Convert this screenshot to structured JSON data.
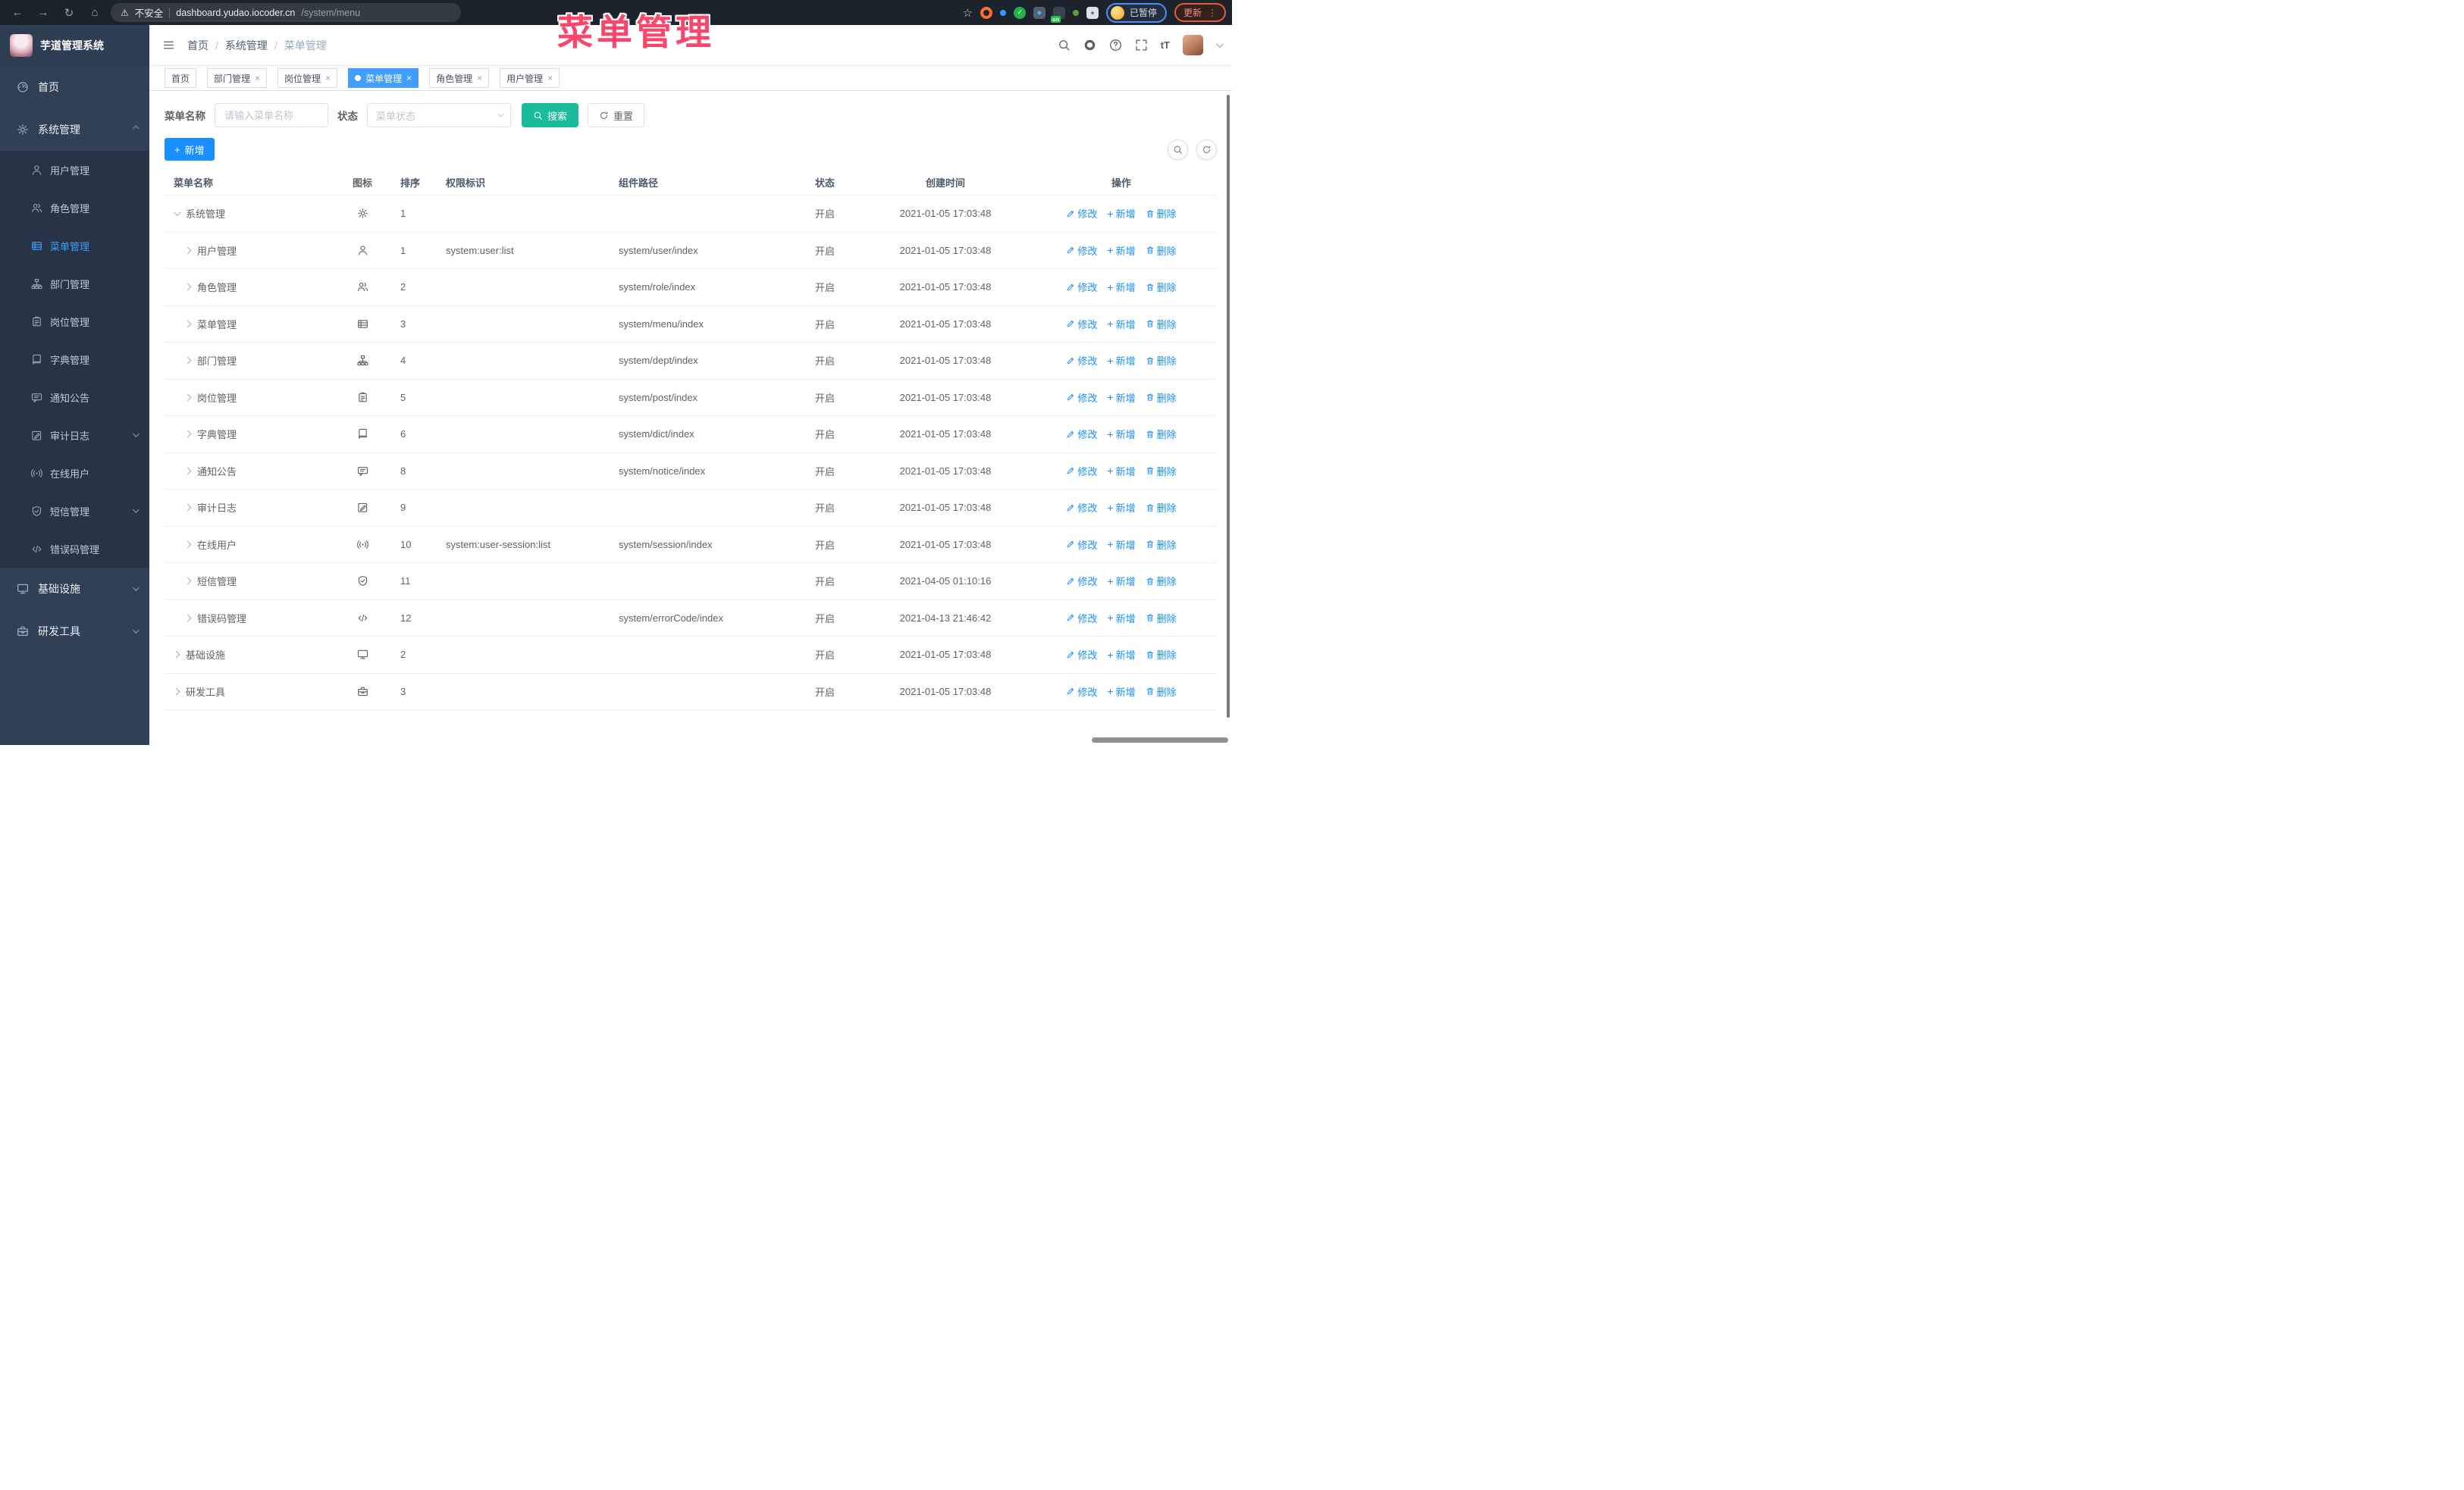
{
  "browser": {
    "security_label": "不安全",
    "url_host": "dashboard.yudao.iocoder.cn",
    "url_path": "/system/menu",
    "extensions": [
      {
        "shape": "ring",
        "color": "#ff6d2e"
      },
      {
        "shape": "dot",
        "color": "#2f9bff"
      },
      {
        "shape": "check",
        "color": "#23b14d"
      },
      {
        "shape": "diamond",
        "color": "#55606e",
        "accent": "#41b4ff"
      },
      {
        "shape": "on",
        "color": "#3a4350",
        "accent": "#23c343"
      },
      {
        "shape": "dot",
        "color": "#5f9c3c"
      },
      {
        "shape": "puzzle",
        "color": "#dfe3e8"
      }
    ],
    "on_badge": "on",
    "profile_badge": "已暂停",
    "update_label": "更新"
  },
  "watermark": "菜单管理",
  "sidebar": {
    "app_title": "芋道管理系统",
    "menu": [
      {
        "label": "首页",
        "icon": "dashboard"
      },
      {
        "label": "系统管理",
        "icon": "gear",
        "caret": "up",
        "children": [
          {
            "label": "用户管理",
            "icon": "user"
          },
          {
            "label": "角色管理",
            "icon": "users"
          },
          {
            "label": "菜单管理",
            "icon": "menu-list",
            "active": true
          },
          {
            "label": "部门管理",
            "icon": "org-tree"
          },
          {
            "label": "岗位管理",
            "icon": "id-badge"
          },
          {
            "label": "字典管理",
            "icon": "book"
          },
          {
            "label": "通知公告",
            "icon": "message"
          },
          {
            "label": "审计日志",
            "icon": "logpen",
            "caret": "down"
          },
          {
            "label": "在线用户",
            "icon": "online"
          },
          {
            "label": "短信管理",
            "icon": "shield",
            "caret": "down"
          },
          {
            "label": "错误码管理",
            "icon": "code"
          }
        ]
      },
      {
        "label": "基础设施",
        "icon": "monitor",
        "caret": "down"
      },
      {
        "label": "研发工具",
        "icon": "toolbox",
        "caret": "down"
      }
    ]
  },
  "header": {
    "breadcrumb": [
      "首页",
      "系统管理",
      "菜单管理"
    ]
  },
  "tabs": [
    {
      "label": "首页",
      "closable": false,
      "active": false
    },
    {
      "label": "部门管理",
      "closable": true,
      "active": false
    },
    {
      "label": "岗位管理",
      "closable": true,
      "active": false
    },
    {
      "label": "菜单管理",
      "closable": true,
      "active": true
    },
    {
      "label": "角色管理",
      "closable": true,
      "active": false
    },
    {
      "label": "用户管理",
      "closable": true,
      "active": false
    }
  ],
  "filter": {
    "name_label": "菜单名称",
    "name_placeholder": "请输入菜单名称",
    "status_label": "状态",
    "status_placeholder": "菜单状态",
    "search_label": "搜索",
    "reset_label": "重置"
  },
  "toolbar": {
    "add_label": "新增"
  },
  "table": {
    "columns": [
      "菜单名称",
      "图标",
      "排序",
      "权限标识",
      "组件路径",
      "状态",
      "创建时间",
      "操作"
    ],
    "actions": {
      "edit": "修改",
      "add": "新增",
      "delete": "删除"
    },
    "rows": [
      {
        "name": "系统管理",
        "level": 0,
        "expanded": true,
        "icon": "gear",
        "sort": "1",
        "perm": "",
        "path": "",
        "status": "开启",
        "created": "2021-01-05 17:03:48"
      },
      {
        "name": "用户管理",
        "level": 1,
        "expanded": false,
        "icon": "user",
        "sort": "1",
        "perm": "system:user:list",
        "path": "system/user/index",
        "status": "开启",
        "created": "2021-01-05 17:03:48"
      },
      {
        "name": "角色管理",
        "level": 1,
        "expanded": false,
        "icon": "users",
        "sort": "2",
        "perm": "",
        "path": "system/role/index",
        "status": "开启",
        "created": "2021-01-05 17:03:48"
      },
      {
        "name": "菜单管理",
        "level": 1,
        "expanded": false,
        "icon": "menu-list",
        "sort": "3",
        "perm": "",
        "path": "system/menu/index",
        "status": "开启",
        "created": "2021-01-05 17:03:48"
      },
      {
        "name": "部门管理",
        "level": 1,
        "expanded": false,
        "icon": "org-tree",
        "sort": "4",
        "perm": "",
        "path": "system/dept/index",
        "status": "开启",
        "created": "2021-01-05 17:03:48"
      },
      {
        "name": "岗位管理",
        "level": 1,
        "expanded": false,
        "icon": "id-badge",
        "sort": "5",
        "perm": "",
        "path": "system/post/index",
        "status": "开启",
        "created": "2021-01-05 17:03:48"
      },
      {
        "name": "字典管理",
        "level": 1,
        "expanded": false,
        "icon": "book",
        "sort": "6",
        "perm": "",
        "path": "system/dict/index",
        "status": "开启",
        "created": "2021-01-05 17:03:48"
      },
      {
        "name": "通知公告",
        "level": 1,
        "expanded": false,
        "icon": "message",
        "sort": "8",
        "perm": "",
        "path": "system/notice/index",
        "status": "开启",
        "created": "2021-01-05 17:03:48"
      },
      {
        "name": "审计日志",
        "level": 1,
        "expanded": false,
        "icon": "logpen",
        "sort": "9",
        "perm": "",
        "path": "",
        "status": "开启",
        "created": "2021-01-05 17:03:48"
      },
      {
        "name": "在线用户",
        "level": 1,
        "expanded": false,
        "icon": "online",
        "sort": "10",
        "perm": "system:user-session:list",
        "path": "system/session/index",
        "status": "开启",
        "created": "2021-01-05 17:03:48"
      },
      {
        "name": "短信管理",
        "level": 1,
        "expanded": false,
        "icon": "shield",
        "sort": "11",
        "perm": "",
        "path": "",
        "status": "开启",
        "created": "2021-04-05 01:10:16"
      },
      {
        "name": "错误码管理",
        "level": 1,
        "expanded": false,
        "icon": "code",
        "sort": "12",
        "perm": "",
        "path": "system/errorCode/index",
        "status": "开启",
        "created": "2021-04-13 21:46:42"
      },
      {
        "name": "基础设施",
        "level": 0,
        "expanded": false,
        "icon": "monitor",
        "sort": "2",
        "perm": "",
        "path": "",
        "status": "开启",
        "created": "2021-01-05 17:03:48"
      },
      {
        "name": "研发工具",
        "level": 0,
        "expanded": false,
        "icon": "toolbox",
        "sort": "3",
        "perm": "",
        "path": "",
        "status": "开启",
        "created": "2021-01-05 17:03:48"
      }
    ]
  }
}
